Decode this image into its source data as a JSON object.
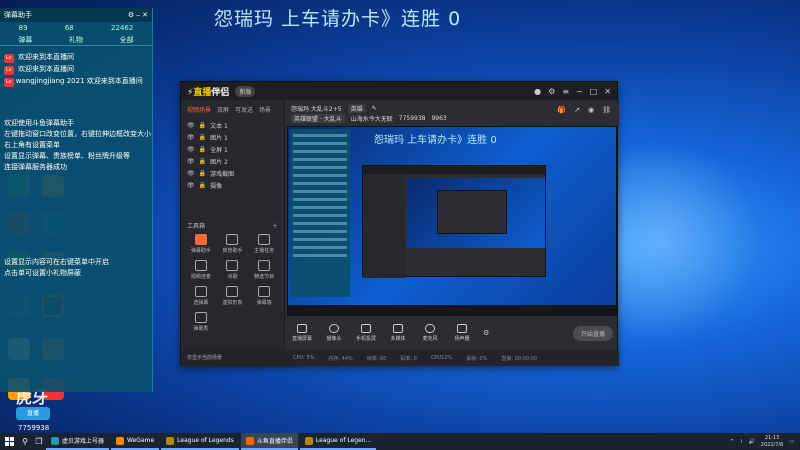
{
  "overlay": {
    "title": "怨瑞玛 上车请办卡》连胜 0"
  },
  "chat": {
    "header_title": "弹幕助手",
    "stats": [
      "89",
      "68",
      "22462"
    ],
    "tabs": [
      "弹幕",
      "礼物",
      "全部"
    ],
    "lines": [
      "欢迎来到本直播间",
      "欢迎来到本直播间",
      "欢迎来到本直播间",
      "欢迎使用斗鱼弹幕助手",
      "左键拖动窗口改变位置，右键拉伸边框改变大小",
      "右上角有设置菜单",
      "设置显示弹幕、贵族榜单、粉丝牌升级等",
      "连接弹幕服务器成功",
      "设置显示内容可在右键菜单中开启",
      "点击单可设置小礼物屏蔽"
    ],
    "users": [
      "",
      "",
      "wangjingjiang 2021"
    ]
  },
  "app": {
    "logo_prefix": "直播",
    "logo_suffix": "伴侣",
    "version": "新版",
    "sidebar_tabs": [
      "视频场景",
      "双屏",
      "可发送",
      "场景"
    ],
    "scenes": [
      "文本 1",
      "图片 1",
      "全屏 1",
      "图片 2",
      "游戏截图",
      "摄像"
    ],
    "toolbox_title": "工具箱",
    "tools": [
      "弹幕助手",
      "房管助手",
      "主播任务",
      "视频连麦",
      "点歌",
      "精选节目",
      "选弹幕",
      "虚拟形象",
      "弹幕墙",
      "弹幕秀"
    ],
    "room_title": "怨瑞玛 大乱斗2+5",
    "room_tag": "英雄",
    "room_category": "英雄联盟 · 大乱斗",
    "room_id": "7759938",
    "room_follow": "9963",
    "room_anchor": "山海水今大无联",
    "controls": [
      "直播屏幕",
      "摄像头",
      "手机投屏",
      "多媒体",
      "麦克风",
      "扬声器"
    ],
    "start_live": "开始直播",
    "status_items": [
      "CPU: 5%",
      "内存: 44%",
      "帧率: 60",
      "码率: 0",
      "CPU12%",
      "丢帧: 0%",
      "直播: 00:00:00"
    ],
    "status_left": "仅显示当前场景"
  },
  "taskbar": {
    "items": [
      "虚贝游戏上号器",
      "WeGame",
      "League of Legends",
      "斗鱼直播伴侣",
      "League of Legen..."
    ],
    "time": "21:13",
    "date": "2022/7/6"
  },
  "desktop": {
    "icons": [
      "",
      "",
      "",
      "",
      "",
      "",
      "",
      "",
      "",
      "",
      "",
      ""
    ],
    "badge_text": "虎牙",
    "badge_box": "直播",
    "counter": "7759938"
  }
}
